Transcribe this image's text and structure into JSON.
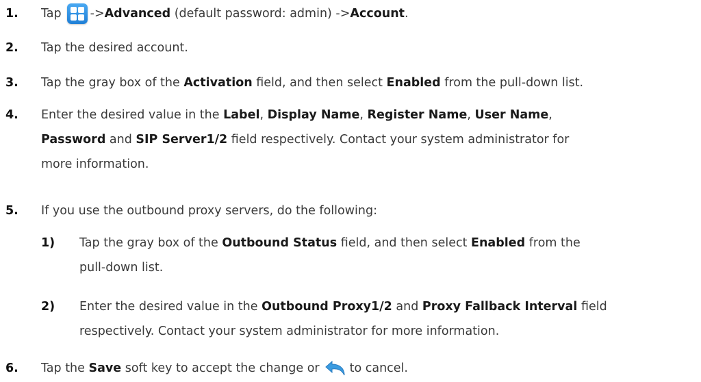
{
  "steps": [
    {
      "num": "1.",
      "parts": [
        "Tap",
        "->",
        "Advanced",
        " (default password: admin) ->",
        "Account",
        "."
      ]
    },
    {
      "num": "2.",
      "text": "Tap the desired account."
    },
    {
      "num": "3.",
      "parts": [
        "Tap the gray box of the ",
        "Activation",
        " field, and then select ",
        "Enabled",
        " from the pull-down list."
      ]
    },
    {
      "num": "4.",
      "line1": [
        "Enter the desired value in the ",
        "Label",
        ", ",
        "Display Name",
        ", ",
        "Register Name",
        ", ",
        "User Name",
        ","
      ],
      "line2": [
        "Password",
        " and ",
        "SIP Server1/2",
        " field respectively. Contact your system administrator for"
      ],
      "line3": "more information."
    },
    {
      "num": "5.",
      "text": "If you use the outbound proxy servers, do the following:",
      "substeps": [
        {
          "num": "1)",
          "line1": [
            "Tap the gray box of the ",
            "Outbound Status",
            " field, and then select ",
            "Enabled",
            " from the"
          ],
          "line2": "pull-down list."
        },
        {
          "num": "2)",
          "line1": [
            "Enter the desired value in the ",
            "Outbound Proxy1/2",
            " and ",
            "Proxy Fallback Interval",
            " field"
          ],
          "line2": "respectively. Contact your system administrator for more information."
        }
      ]
    },
    {
      "num": "6.",
      "parts": [
        "Tap the ",
        "Save",
        " soft key to accept the change or",
        "to cancel."
      ]
    }
  ],
  "icons": {
    "menu": "menu-grid-icon",
    "back": "back-arrow-icon",
    "menu_color": "#2b8de3",
    "back_color": "#3a9be0"
  }
}
